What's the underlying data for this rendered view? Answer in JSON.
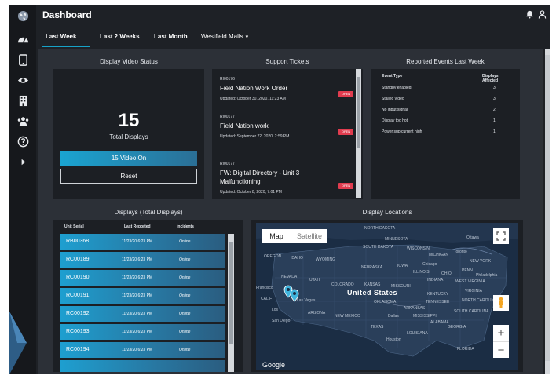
{
  "app": {
    "title": "Dashboard"
  },
  "sidebar": {
    "items": [
      {
        "name": "globe",
        "icon": "globe-icon"
      },
      {
        "name": "dashboard",
        "icon": "speedometer-icon"
      },
      {
        "name": "devices",
        "icon": "tablet-icon"
      },
      {
        "name": "view",
        "icon": "eye-icon"
      },
      {
        "name": "buildings",
        "icon": "building-icon"
      },
      {
        "name": "users",
        "icon": "users-icon"
      },
      {
        "name": "help",
        "icon": "help-icon"
      },
      {
        "name": "expand",
        "icon": "play-icon"
      }
    ]
  },
  "tabs": [
    {
      "label": "Last Week",
      "active": true
    },
    {
      "label": "Last 2 Weeks",
      "active": false
    },
    {
      "label": "Last Month",
      "active": false
    },
    {
      "label": "Westfield Malls",
      "active": false
    }
  ],
  "video_status": {
    "title": "Display Video Status",
    "total": "15",
    "total_label": "Total Displays",
    "video_on": "15 Video On",
    "reset": "Reset"
  },
  "tickets": {
    "title": "Support Tickets",
    "items": [
      {
        "id": "RI00176",
        "title": "Field Nation Work Order",
        "updated": "Updated: October 30, 2020, 11:23 AM",
        "status": "OPEN"
      },
      {
        "id": "RI00177",
        "title": "Field Nation work",
        "updated": "Updated: September 22, 2020, 2:59 PM",
        "status": "OPEN"
      },
      {
        "id": "RI00177",
        "title": "FW: Digital Directory - Unit 3 Malfunctioning",
        "updated": "Updated: October 8, 2020, 7:01 PM",
        "status": "OPEN"
      }
    ]
  },
  "events": {
    "title": "Reported Events Last Week",
    "col_type": "Event Type",
    "col_affected": "Displays Affected",
    "rows": [
      {
        "type": "Standby enabled",
        "count": "3"
      },
      {
        "type": "Stalled video",
        "count": "3"
      },
      {
        "type": "No input signal",
        "count": "2"
      },
      {
        "type": "Display too hot",
        "count": "1"
      },
      {
        "type": "Power sup current high",
        "count": "1"
      }
    ]
  },
  "displays": {
    "title": "Displays  (Total Displays)",
    "col_serial": "Unit Serial",
    "col_reported": "Last Reported",
    "col_incidents": "Incidents",
    "rows": [
      {
        "serial": "RB00368",
        "reported": "11/23/20 6:23 PM",
        "status": "Online"
      },
      {
        "serial": "RC00189",
        "reported": "11/23/20 6:23 PM",
        "status": "Online"
      },
      {
        "serial": "RC00190",
        "reported": "11/23/20 6:23 PM",
        "status": "Online"
      },
      {
        "serial": "RC00191",
        "reported": "11/23/20 6:23 PM",
        "status": "Online"
      },
      {
        "serial": "RC00192",
        "reported": "11/23/20 6:23 PM",
        "status": "Online"
      },
      {
        "serial": "RC00193",
        "reported": "11/23/20 6:23 PM",
        "status": "Online"
      },
      {
        "serial": "RC00194",
        "reported": "11/23/20 6:23 PM",
        "status": "Online"
      }
    ]
  },
  "map": {
    "title": "Display Locations",
    "map_label": "Map",
    "satellite_label": "Satellite",
    "country": "United States",
    "google": "Google",
    "labels": {
      "north_dakota": "NORTH DAKOTA",
      "minnesota": "MINNESOTA",
      "ottawa": "Ottawa",
      "south_dakota": "SOUTH DAKOTA",
      "wisconsin": "WISCONSIN",
      "michigan": "MICHIGAN",
      "toronto": "Toronto",
      "oregon": "OREGON",
      "idaho": "IDAHO",
      "wyoming": "WYOMING",
      "chicago": "Chicago",
      "new_york": "NEW YORK",
      "nebraska": "NEBRASKA",
      "iowa": "IOWA",
      "illinois": "ILLINOIS",
      "ohio": "OHIO",
      "penn": "PENN",
      "nevada": "NEVADA",
      "utah": "UTAH",
      "colorado": "COLORADO",
      "kansas": "KANSAS",
      "missouri": "MISSOURI",
      "indiana": "INDIANA",
      "west_virginia": "WEST VIRGINIA",
      "philadelphia": "Philadelphia",
      "san_francisco": "Francisco",
      "calif": "CALIF",
      "las_vegas": "Las Vegas",
      "kentucky": "KENTUCKY",
      "virginia": "VIRGINIA",
      "los_angeles": "Los",
      "arizona": "ARIZONA",
      "oklahoma": "OKLAHOMA",
      "tennessee": "TENNESSEE",
      "north_carolina": "NORTH CAROLINA",
      "new_mexico": "NEW MEXICO",
      "arkansas": "ARKANSAS",
      "south_carolina": "SOUTH CAROLINA",
      "san_diego": "San Diego",
      "dallas": "Dallas",
      "mississippi": "MISSISSIPPI",
      "alabama": "ALABAMA",
      "georgia": "GEORGIA",
      "texas": "TEXAS",
      "louisiana": "LOUISIANA",
      "houston": "Houston",
      "florida": "FLORIDA"
    }
  },
  "colors": {
    "accent": "#17a2c7",
    "badge": "#e13c4f",
    "panel": "#1c1f24",
    "background": "#2c3037"
  }
}
